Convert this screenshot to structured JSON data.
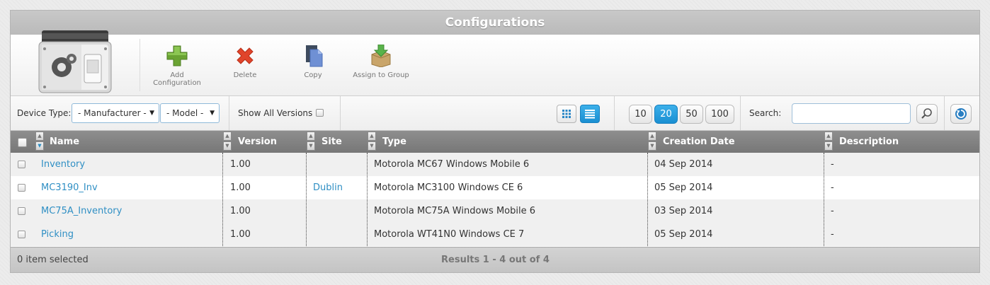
{
  "window": {
    "title": "Configurations"
  },
  "toolbar": {
    "add_label": "Add Configuration",
    "delete_label": "Delete",
    "copy_label": "Copy",
    "assign_label": "Assign to Group"
  },
  "filters": {
    "device_type_label": "Device Type:",
    "manufacturer_value": "- Manufacturer -",
    "model_value": "- Model -",
    "show_all_versions_label": "Show All Versions"
  },
  "pagination": {
    "sizes": [
      "10",
      "20",
      "50",
      "100"
    ],
    "active": "20"
  },
  "search": {
    "label": "Search:",
    "value": ""
  },
  "table": {
    "columns": [
      "Name",
      "Version",
      "Site",
      "Type",
      "Creation Date",
      "Description"
    ],
    "rows": [
      {
        "name": "Inventory",
        "version": "1.00",
        "site": "",
        "type": "Motorola MC67 Windows Mobile 6",
        "date": "04 Sep 2014",
        "description": "-"
      },
      {
        "name": "MC3190_Inv",
        "version": "1.00",
        "site": "Dublin",
        "type": "Motorola MC3100 Windows CE 6",
        "date": "05 Sep 2014",
        "description": "-"
      },
      {
        "name": "MC75A_Inventory",
        "version": "1.00",
        "site": "",
        "type": "Motorola MC75A Windows Mobile 6",
        "date": "03 Sep 2014",
        "description": "-"
      },
      {
        "name": "Picking",
        "version": "1.00",
        "site": "",
        "type": "Motorola WT41N0 Windows CE 7",
        "date": "05 Sep 2014",
        "description": "-"
      }
    ]
  },
  "footer": {
    "selected": "0 item selected",
    "results": "Results 1 - 4 out of 4"
  },
  "colors": {
    "accent": "#1a8fd2",
    "link": "#2f8fc4",
    "header_bg": "#777777"
  }
}
